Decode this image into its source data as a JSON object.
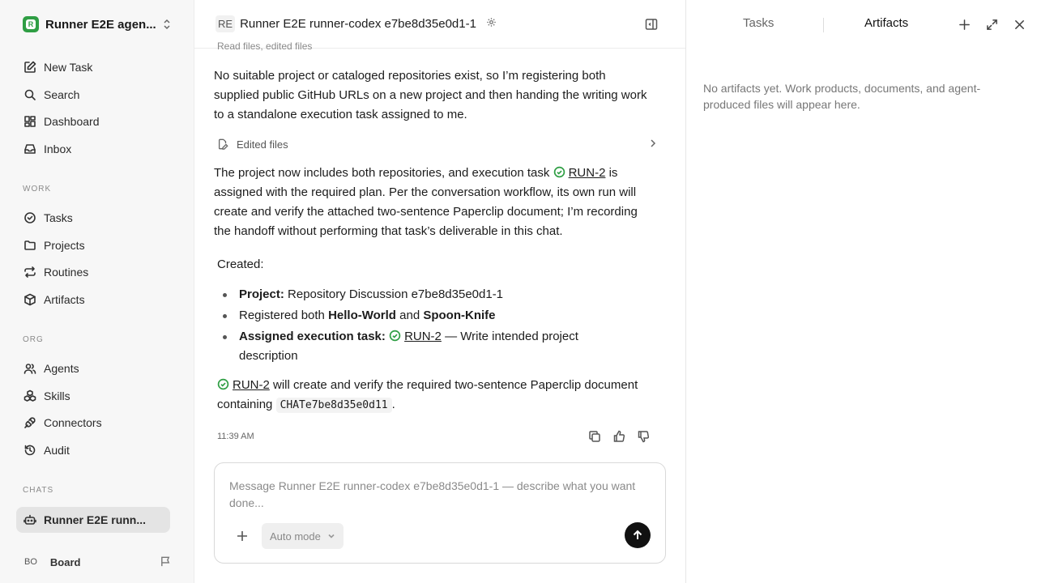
{
  "workspace": {
    "name": "Runner E2E agen...",
    "logo_letter": "R"
  },
  "nav": {
    "new_task": "New Task",
    "search": "Search",
    "dashboard": "Dashboard",
    "inbox": "Inbox",
    "work_label": "WORK",
    "tasks": "Tasks",
    "projects": "Projects",
    "routines": "Routines",
    "artifacts": "Artifacts",
    "org_label": "ORG",
    "agents": "Agents",
    "skills": "Skills",
    "connectors": "Connectors",
    "audit": "Audit",
    "chats_label": "CHATS",
    "chat_item": "Runner E2E runn..."
  },
  "board": {
    "avatar": "BO",
    "name": "Board"
  },
  "header": {
    "avatar": "RE",
    "title": "Runner E2E runner-codex e7be8d35e0d1-1"
  },
  "chat": {
    "read_files": "Read files, edited files",
    "para1": "No suitable project or cataloged repositories exist, so I’m registering both supplied public GitHub URLs on a new project and then handing the writing work to a standalone execution task assigned to me.",
    "edited_files": "Edited files",
    "para2_a": "The project now includes both repositories, and execution task ",
    "run_link": "RUN-2",
    "para2_b": " is assigned with the required plan. Per the conversation workflow, its own run will create and verify the attached two-sentence Paperclip document; I’m recording the handoff without performing that task’s deliverable in this chat.",
    "created_label": "Created:",
    "item1_bold": "Project:",
    "item1_text": " Repository Discussion e7be8d35e0d1-1",
    "item2_a": "Registered both ",
    "item2_b": "Hello-World",
    "item2_c": " and ",
    "item2_d": "Spoon-Knife",
    "item3_bold": "Assigned execution task:",
    "item3_text": " — Write intended project description",
    "final_a": " will create and verify the required two-sentence Paperclip document containing ",
    "final_code": "CHATe7be8d35e0d11",
    "final_b": ".",
    "time": "11:39 AM"
  },
  "composer": {
    "placeholder": "Message Runner E2E runner-codex e7be8d35e0d1-1 — describe what you want done...",
    "mode": "Auto mode"
  },
  "right_panel": {
    "tab_tasks": "Tasks",
    "tab_artifacts": "Artifacts",
    "empty_text": "No artifacts yet. Work products, documents, and agent-produced files will appear here."
  }
}
